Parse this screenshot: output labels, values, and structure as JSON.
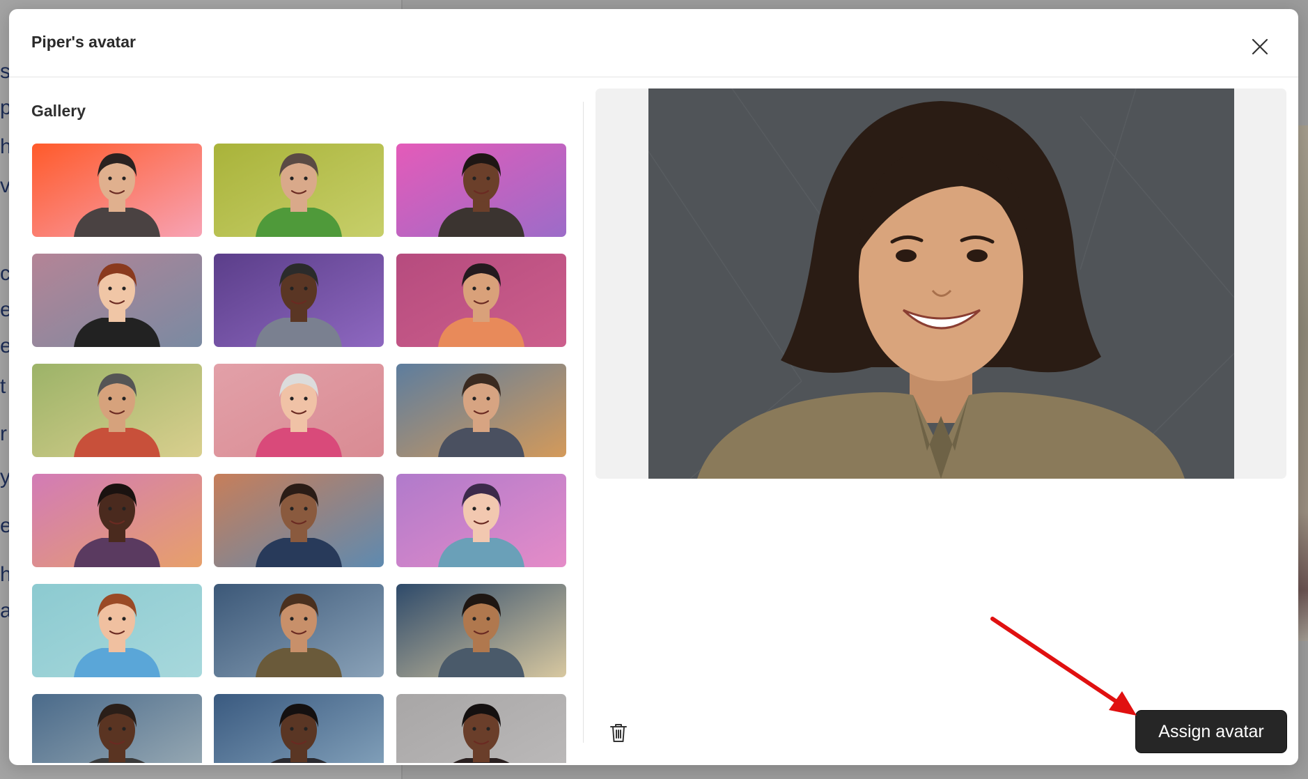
{
  "dialog": {
    "title": "Piper's avatar",
    "close_icon": "close-icon"
  },
  "gallery": {
    "label": "Gallery",
    "items": [
      {
        "name": "man-glasses-orange",
        "bg1": "#ff5a2a",
        "bg2": "#f7a3b5",
        "skin": "#e0b08e",
        "hair": "#2a2220",
        "shirt": "#4a4242"
      },
      {
        "name": "older-woman-green",
        "bg1": "#a9b33a",
        "bg2": "#c7cf6a",
        "skin": "#d9a98a",
        "hair": "#5a4a44",
        "shirt": "#4f9a3a"
      },
      {
        "name": "woman-pink-purple",
        "bg1": "#e45bb9",
        "bg2": "#9c6cc8",
        "skin": "#6b3f2a",
        "hair": "#1e1614",
        "shirt": "#3b3430"
      },
      {
        "name": "woman-red-hair",
        "bg1": "#b48496",
        "bg2": "#7a8aa2",
        "skin": "#f0c6a6",
        "hair": "#8a3a1e",
        "shirt": "#222222"
      },
      {
        "name": "man-fedora-purple",
        "bg1": "#5b3e8a",
        "bg2": "#8e68c0",
        "skin": "#5a3624",
        "hair": "#2b2b2b",
        "shirt": "#7a8090"
      },
      {
        "name": "woman-pink-hoodie",
        "bg1": "#b64b7e",
        "bg2": "#cc5f8c",
        "skin": "#d9a17a",
        "hair": "#241a1e",
        "shirt": "#e88a5a"
      },
      {
        "name": "older-man-green",
        "bg1": "#9cb368",
        "bg2": "#d9cf8e",
        "skin": "#d6a27c",
        "hair": "#555555",
        "shirt": "#c8503a"
      },
      {
        "name": "older-woman-pink",
        "bg1": "#e2a0a8",
        "bg2": "#d98b93",
        "skin": "#f0c2a6",
        "hair": "#dcdcdc",
        "shirt": "#d94a7a"
      },
      {
        "name": "man-suit-painterly",
        "bg1": "#5d7d9e",
        "bg2": "#d49a5a",
        "skin": "#d7a482",
        "hair": "#3a2a20",
        "shirt": "#4a5060"
      },
      {
        "name": "man-painterly-pink",
        "bg1": "#d27bb6",
        "bg2": "#e7a06a",
        "skin": "#4a2a1e",
        "hair": "#1a1210",
        "shirt": "#5a3a60"
      },
      {
        "name": "woman-curly-painterly",
        "bg1": "#c77e5a",
        "bg2": "#5e8ab0",
        "skin": "#8a5a3e",
        "hair": "#2a1c16",
        "shirt": "#283a5a"
      },
      {
        "name": "cartoon-purple-hair",
        "bg1": "#b07acb",
        "bg2": "#e58cc8",
        "skin": "#f2c8b0",
        "hair": "#3c2a4a",
        "shirt": "#6aa0b8"
      },
      {
        "name": "cartoon-man-teal",
        "bg1": "#8ccad0",
        "bg2": "#a7d8dc",
        "skin": "#f0c0a0",
        "hair": "#9a4a26",
        "shirt": "#5aa6d8"
      },
      {
        "name": "woman-blue-wash",
        "bg1": "#3c5878",
        "bg2": "#8aa2b8",
        "skin": "#c8906a",
        "hair": "#4a301e",
        "shirt": "#6a5a3a"
      },
      {
        "name": "man-smiling-blue",
        "bg1": "#2e4a6a",
        "bg2": "#d8c8a0",
        "skin": "#b0784e",
        "hair": "#1e1612",
        "shirt": "#4a5a6a"
      },
      {
        "name": "woman-headwrap",
        "bg1": "#4a6a8a",
        "bg2": "#a0b0b8",
        "skin": "#5a3422",
        "hair": "#2a1e18",
        "shirt": "#3a3a3a"
      },
      {
        "name": "man-blue-wash",
        "bg1": "#3a5a80",
        "bg2": "#8aa8c0",
        "skin": "#5a3624",
        "hair": "#141010",
        "shirt": "#2a2a30"
      },
      {
        "name": "woman-gray-bg",
        "bg1": "#a8a6a6",
        "bg2": "#bdbbbb",
        "skin": "#6a3e2a",
        "hair": "#141010",
        "shirt": "#2a2020"
      }
    ]
  },
  "preview": {
    "alt": "Selected avatar preview",
    "bg": "#505458",
    "skin": "#d9a47c",
    "hair": "#2a1c14",
    "jacket": "#8a7a5a"
  },
  "actions": {
    "delete_icon": "trash-icon",
    "assign_label": "Assign avatar"
  },
  "colors": {
    "annotation_arrow": "#e01010",
    "primary_button": "#262626"
  }
}
